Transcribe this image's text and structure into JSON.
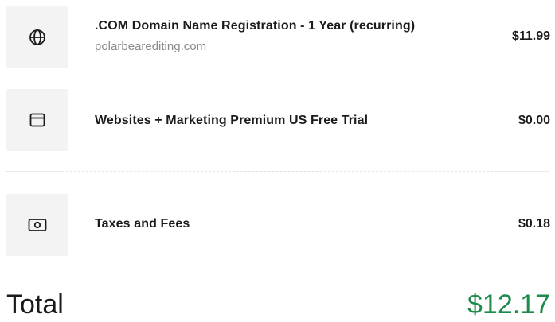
{
  "line_items": [
    {
      "icon": "globe-icon",
      "title": ".COM Domain Name Registration - 1 Year (recurring)",
      "subtitle": "polarbearediting.com",
      "price": "$11.99"
    },
    {
      "icon": "browser-window-icon",
      "title": "Websites + Marketing Premium US Free Trial",
      "price": "$0.00"
    },
    {
      "icon": "cash-icon",
      "title": "Taxes and Fees",
      "price": "$0.18"
    }
  ],
  "total": {
    "label": "Total",
    "value": "$12.17",
    "value_color": "#1e8a4c"
  }
}
